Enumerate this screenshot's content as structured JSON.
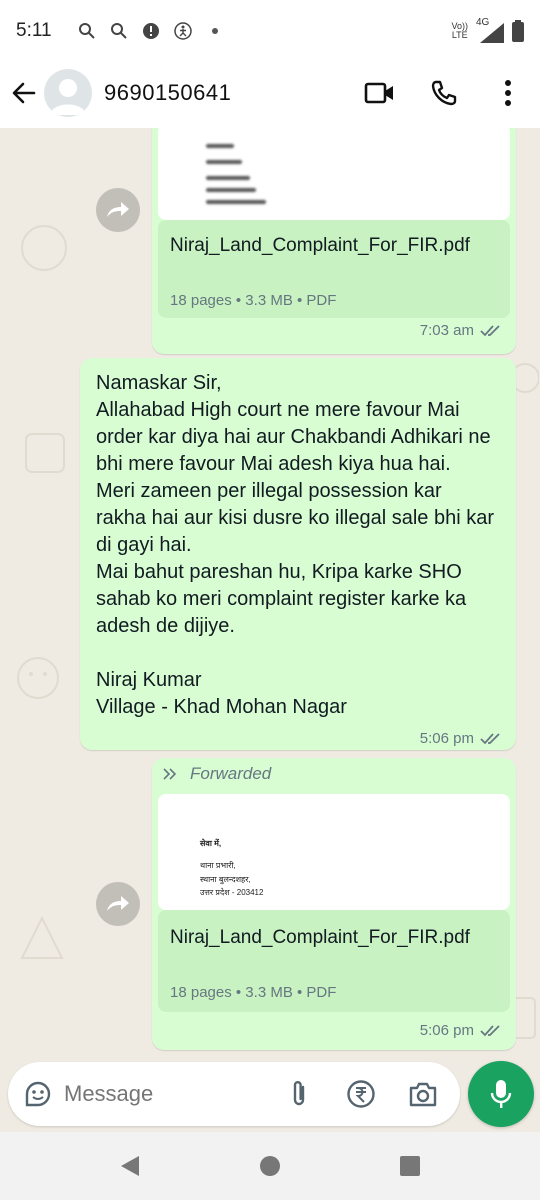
{
  "status_bar": {
    "time": "5:11",
    "network_top": "Vo))",
    "network_bottom": "LTE",
    "signal_label": "4G"
  },
  "header": {
    "contact": "9690150641"
  },
  "messages": [
    {
      "type": "document",
      "file_name": "Niraj_Land_Complaint_For_FIR.pdf",
      "meta": "18 pages • 3.3 MB • PDF",
      "time": "7:03 am"
    },
    {
      "type": "text",
      "text": "Namaskar Sir,\nAllahabad High court ne mere favour Mai order kar diya hai aur Chakbandi Adhikari ne bhi mere favour Mai adesh kiya hua hai.\nMeri zameen per illegal possession kar rakha hai aur kisi dusre ko illegal sale bhi kar di gayi hai.\nMai bahut pareshan hu, Kripa karke SHO sahab ko meri complaint register karke ka adesh de dijiye.\n\nNiraj Kumar\nVillage - Khad Mohan Nagar",
      "time": "5:06 pm"
    },
    {
      "type": "document",
      "forwarded_label": "Forwarded",
      "preview_lines": [
        "सेवा में,",
        "थाना प्रभारी,",
        "स्थाना बुलन्दशहर,",
        "उत्तर प्रदेश - 203412"
      ],
      "file_name": "Niraj_Land_Complaint_For_FIR.pdf",
      "meta": "18 pages • 3.3 MB • PDF",
      "time": "5:06 pm"
    }
  ],
  "composer": {
    "placeholder": "Message"
  },
  "colors": {
    "bubble_out": "#d9fdd3",
    "chat_bg": "#efeae2",
    "accent": "#1aa260",
    "read_tick": "#667781"
  }
}
